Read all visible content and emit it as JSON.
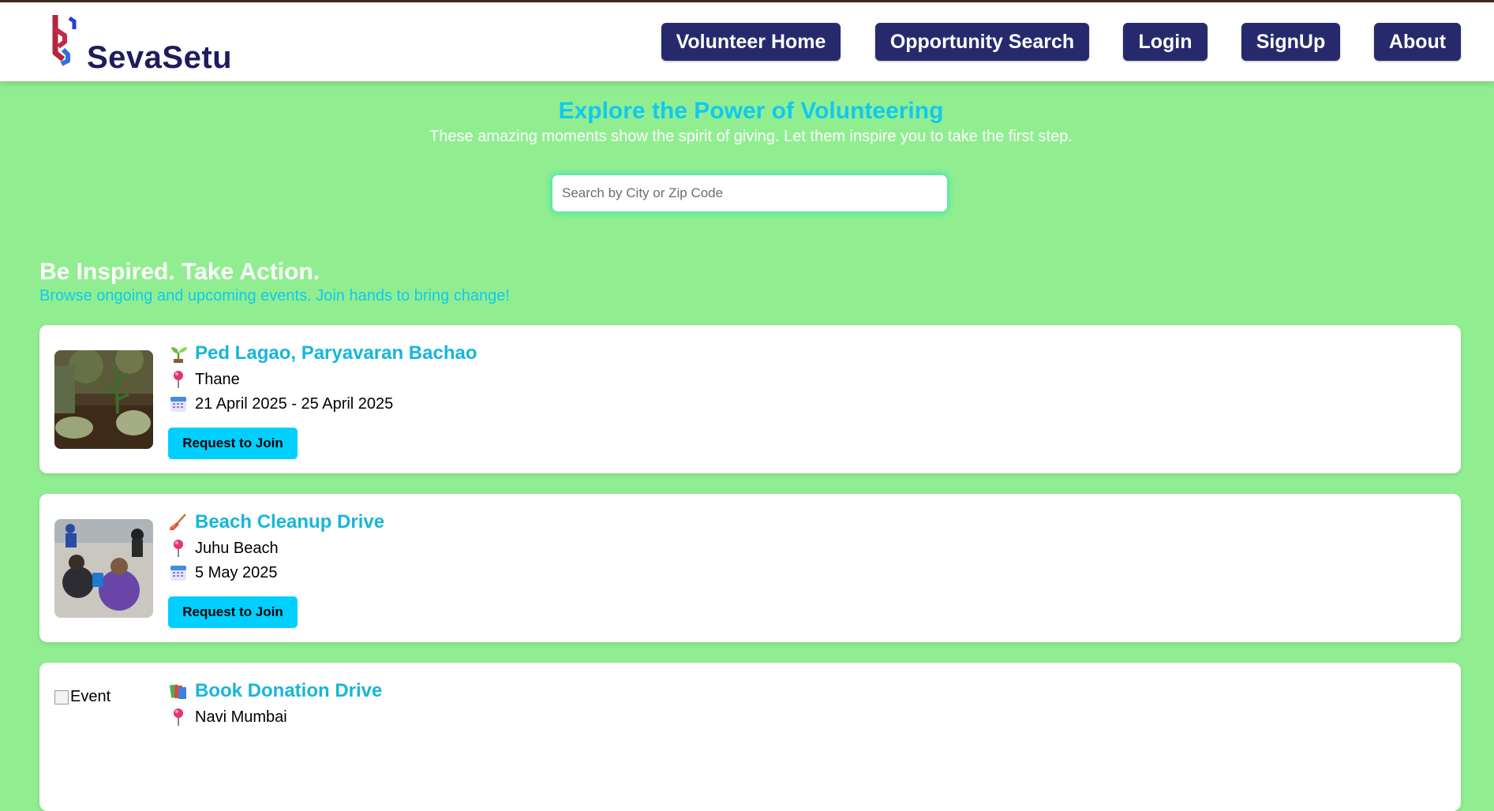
{
  "brand": {
    "name": "SevaSetu"
  },
  "nav": [
    "Volunteer Home",
    "Opportunity Search",
    "Login",
    "SignUp",
    "About"
  ],
  "hero": {
    "title": "Explore the Power of Volunteering",
    "subtitle": "These amazing moments show the spirit of giving. Let them inspire you to take the first step."
  },
  "search": {
    "placeholder": "Search by City or Zip Code",
    "value": ""
  },
  "section": {
    "title": "Be Inspired. Take Action.",
    "subtitle": "Browse ongoing and upcoming events. Join hands to bring change!"
  },
  "events": [
    {
      "icon": "seedling-icon",
      "title": "Ped Lagao, Paryavaran Bachao",
      "location": "Thane",
      "dates": "21 April 2025 - 25 April 2025",
      "button": "Request to Join"
    },
    {
      "icon": "broom-icon",
      "title": "Beach Cleanup Drive",
      "location": "Juhu Beach",
      "dates": "5 May 2025",
      "button": "Request to Join"
    },
    {
      "icon": "books-icon",
      "title": "Book Donation Drive",
      "location": "Navi Mumbai",
      "image_alt": "Event"
    }
  ],
  "colors": {
    "page_bg": "#90ee90",
    "nav_button": "#262a6d",
    "accent_cyan": "#12c8f0",
    "join_button": "#00cfff",
    "brand_text": "#1e1b5e"
  }
}
